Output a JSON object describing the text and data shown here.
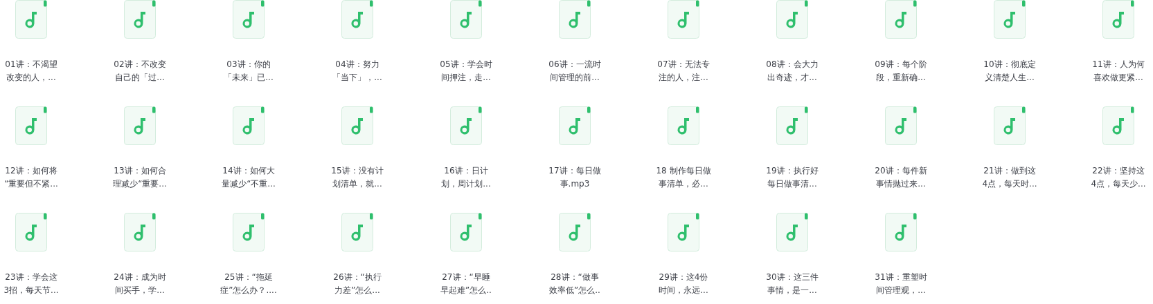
{
  "files": [
    {
      "lines": [
        "01讲：不渴望",
        "改变的人，..."
      ]
    },
    {
      "lines": [
        "02讲：不改变",
        "自己的「过..."
      ]
    },
    {
      "lines": [
        "03讲：你的",
        "「未来」已..."
      ]
    },
    {
      "lines": [
        "04讲：努力",
        "「当下」，..."
      ]
    },
    {
      "lines": [
        "05讲：学会时",
        "间押注，走..."
      ]
    },
    {
      "lines": [
        "06讲：一流时",
        "间管理的前..."
      ]
    },
    {
      "lines": [
        "07讲：无法专",
        "注的人，注..."
      ]
    },
    {
      "lines": [
        "08讲：会大力",
        "出奇迹，才..."
      ]
    },
    {
      "lines": [
        "09讲：每个阶",
        "段，重新确..."
      ]
    },
    {
      "lines": [
        "10讲：彻底定",
        "义清楚人生..."
      ]
    },
    {
      "lines": [
        "11讲：人为何",
        "喜欢做更紧..."
      ]
    },
    {
      "lines": [
        "12讲：如何将",
        "“重要但不紧..."
      ]
    },
    {
      "lines": [
        "13讲：如何合",
        "理减少“重要..."
      ]
    },
    {
      "lines": [
        "14讲：如何大",
        "量减少“不重..."
      ]
    },
    {
      "lines": [
        "15讲：没有计",
        "划清单，就..."
      ]
    },
    {
      "lines": [
        "16讲：日计",
        "划，周计划..."
      ]
    },
    {
      "lines": [
        "17讲：每日做",
        "事.mp3"
      ]
    },
    {
      "lines": [
        "18 制作每日做",
        "事清单，必..."
      ]
    },
    {
      "lines": [
        "19讲：执行好",
        "每日做事清..."
      ]
    },
    {
      "lines": [
        "20讲：每件新",
        "事情抛过来..."
      ]
    },
    {
      "lines": [
        "21讲：做到这",
        "4点，每天时..."
      ]
    },
    {
      "lines": [
        "22讲：坚持这",
        "4点，每天少..."
      ]
    },
    {
      "lines": [
        "23讲：学会这",
        "3招，每天节..."
      ]
    },
    {
      "lines": [
        "24讲：成为时",
        "间买手，学..."
      ]
    },
    {
      "lines": [
        "25讲：“拖延",
        "症”怎么办？...."
      ]
    },
    {
      "lines": [
        "26讲：“执行",
        "力差”怎么..."
      ]
    },
    {
      "lines": [
        "27讲：“早睡",
        "早起难”怎么.."
      ]
    },
    {
      "lines": [
        "28讲：“做事",
        "效率低”怎么.."
      ]
    },
    {
      "lines": [
        "29讲：这4份",
        "时间，永远..."
      ]
    },
    {
      "lines": [
        "30讲：这三件",
        "事情，是一..."
      ]
    },
    {
      "lines": [
        "31讲：重塑时",
        "间管理观，..."
      ]
    }
  ]
}
